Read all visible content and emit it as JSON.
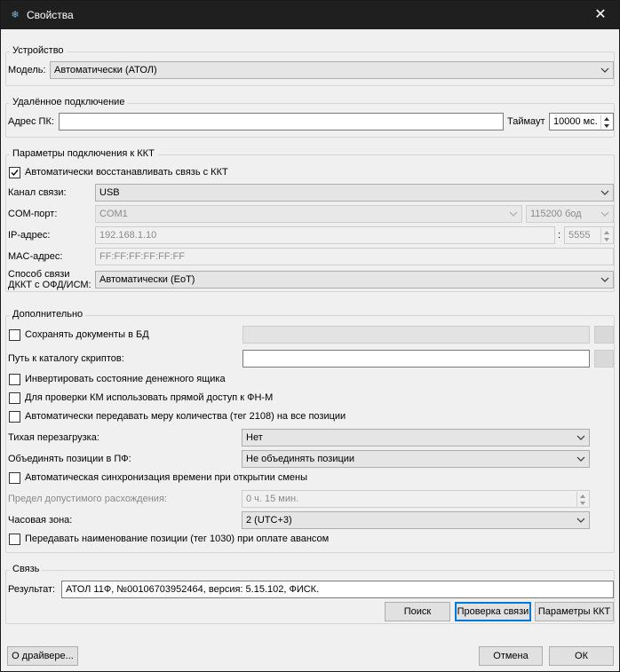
{
  "window": {
    "title": "Свойства",
    "close_glyph": "✕",
    "app_icon": "snowflake-icon"
  },
  "device": {
    "legend": "Устройство",
    "model_label": "Модель:",
    "model_value": "Автоматически (АТОЛ)"
  },
  "remote": {
    "legend": "Удалённое подключение",
    "pc_address_label": "Адрес ПК:",
    "pc_address_value": "",
    "timeout_label": "Таймаут",
    "timeout_value": "10000 мс."
  },
  "connection": {
    "legend": "Параметры подключения к ККТ",
    "auto_restore_label": "Автоматически восстанавливать связь с ККТ",
    "auto_restore_checked": true,
    "channel_label": "Канал связи:",
    "channel_value": "USB",
    "com_label": "COM-порт:",
    "com_value": "COM1",
    "baud_value": "115200 бод",
    "ip_label": "IP-адрес:",
    "ip_value": "192.168.1.10",
    "port_separator": ":",
    "port_value": "5555",
    "mac_label": "MAC-адрес:",
    "mac_value": "FF:FF:FF:FF:FF:FF",
    "ofd_label_line1": "Способ связи",
    "ofd_label_line2": "ДККТ с ОФД/ИСМ:",
    "ofd_value": "Автоматически (EoT)"
  },
  "extra": {
    "legend": "Дополнительно",
    "save_docs_label": "Сохранять документы в БД",
    "save_docs_path": "",
    "scripts_label": "Путь к каталогу скриптов:",
    "scripts_value": "",
    "invert_drawer_label": "Инвертировать состояние денежного ящика",
    "km_direct_label": "Для проверки КМ использовать прямой доступ к ФН-М",
    "measure_label": "Автоматически передавать меру количества (тег 2108) на все позиции",
    "silent_reboot_label": "Тихая перезагрузка:",
    "silent_reboot_value": "Нет",
    "merge_label": "Объединять позиции в ПФ:",
    "merge_value": "Не объединять позиции",
    "time_sync_label": "Автоматическая синхронизация времени при открытии смены",
    "max_diff_label": "Предел допустимого расхождения:",
    "max_diff_value": "0 ч. 15 мин.",
    "timezone_label": "Часовая зона:",
    "timezone_value": "2 (UTC+3)",
    "item_name_label": "Передавать наименование позиции (тег 1030) при оплате авансом"
  },
  "link": {
    "legend": "Связь",
    "result_label": "Результат:",
    "result_value": "АТОЛ 11Ф, №00106703952464, версия: 5.15.102, ФИСК.",
    "search_button": "Поиск",
    "check_button": "Проверка связи",
    "kkt_params_button": "Параметры ККТ"
  },
  "footer": {
    "about_button": "О драйвере...",
    "cancel_button": "Отмена",
    "ok_button": "ОК"
  }
}
